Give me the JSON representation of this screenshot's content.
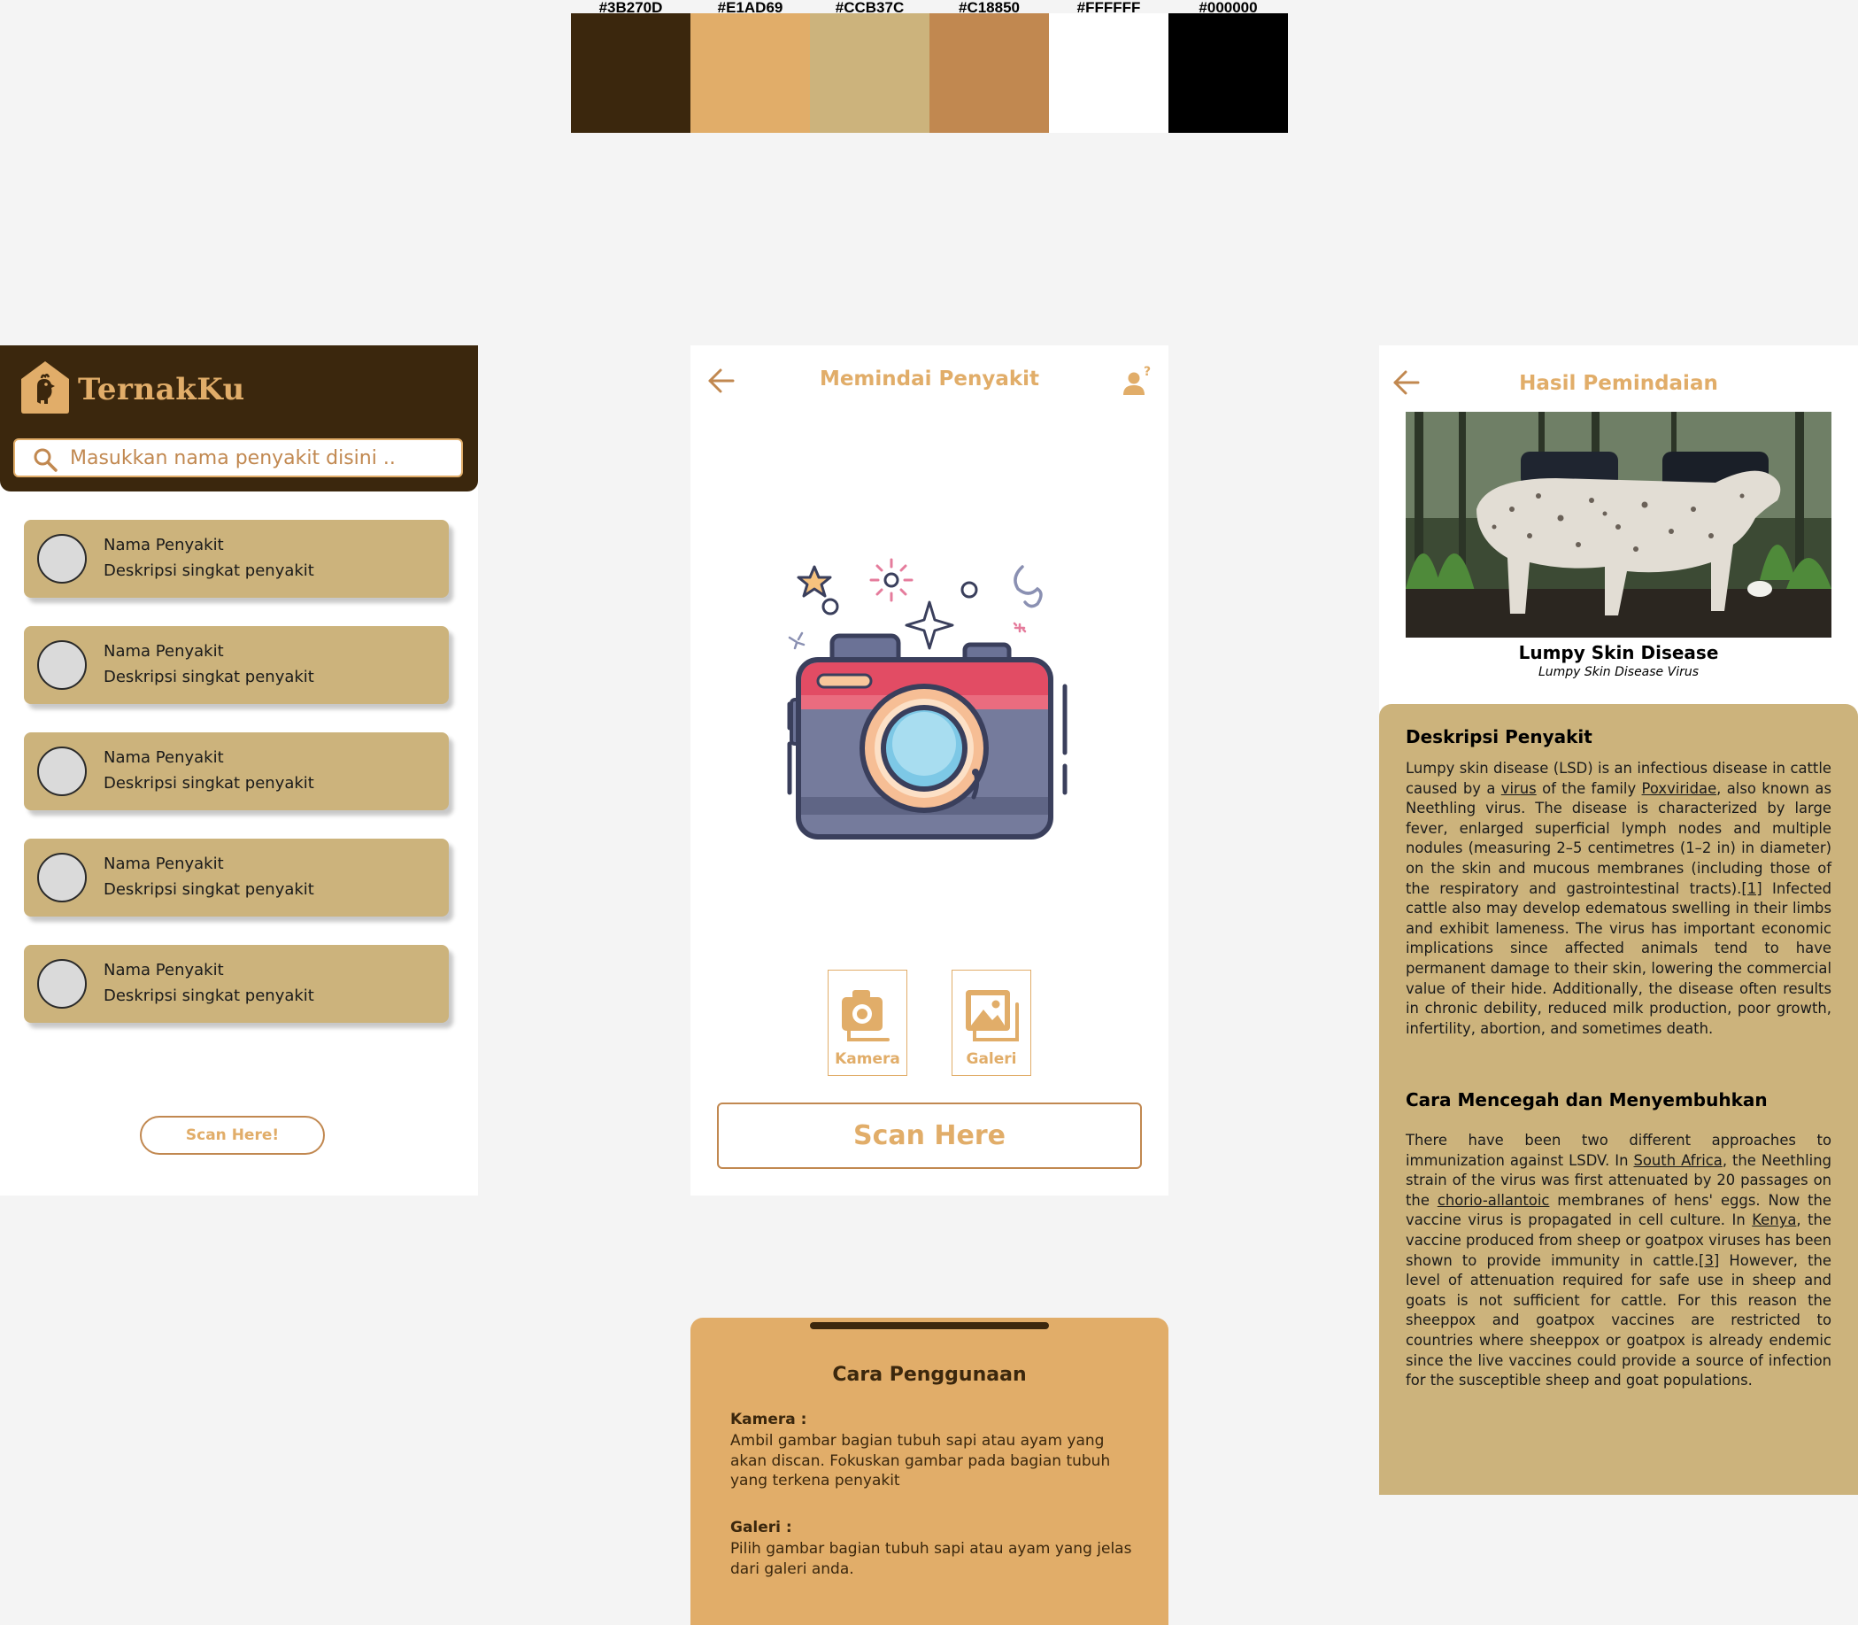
{
  "palette": [
    {
      "label": "#3B270D",
      "color": "#3B270D"
    },
    {
      "label": "#E1AD69",
      "color": "#E1AD69"
    },
    {
      "label": "#CCB37C",
      "color": "#CCB37C"
    },
    {
      "label": "#C18850",
      "color": "#C18850"
    },
    {
      "label": "#FFFFFF",
      "color": "#FFFFFF"
    },
    {
      "label": "#000000",
      "color": "#000000"
    }
  ],
  "home": {
    "app_name": "TernakKu",
    "logo_icon": "house-chicken-icon",
    "search_placeholder": "Masukkan nama penyakit disini ..",
    "items": [
      {
        "title": "Nama Penyakit",
        "desc": "Deskripsi singkat penyakit"
      },
      {
        "title": "Nama Penyakit",
        "desc": "Deskripsi singkat penyakit"
      },
      {
        "title": "Nama Penyakit",
        "desc": "Deskripsi singkat penyakit"
      },
      {
        "title": "Nama Penyakit",
        "desc": "Deskripsi singkat penyakit"
      },
      {
        "title": "Nama Penyakit",
        "desc": "Deskripsi singkat penyakit"
      }
    ],
    "scan_button": "Scan Here!"
  },
  "scan": {
    "title": "Memindai Penyakit",
    "camera_option": "Kamera",
    "gallery_option": "Galeri",
    "scan_button": "Scan Here"
  },
  "guide": {
    "title": "Cara Penggunaan",
    "kamera_heading": "Kamera :",
    "kamera_text": "Ambil gambar bagian tubuh sapi atau ayam yang akan discan. Fokuskan gambar pada bagian tubuh yang terkena penyakit",
    "galeri_heading": "Galeri :",
    "galeri_text": "Pilih gambar bagian tubuh sapi atau ayam yang jelas dari galeri anda."
  },
  "result": {
    "title": "Hasil Pemindaian",
    "disease_name": "Lumpy Skin Disease",
    "disease_sub": "Lumpy Skin Disease Virus",
    "desc_heading": "Deskripsi Penyakit",
    "desc": {
      "p1": "Lumpy skin disease (LSD) is an infectious disease in cattle caused by a ",
      "l1": "virus",
      "p2": " of the family ",
      "l2": "Poxviridae",
      "p3": ", also known as Neethling virus. The disease is characterized by large fever, enlarged superficial lymph nodes and multiple nodules (measuring 2–5 centimetres (1–2 in) in diameter) on the skin and mucous membranes (including those of the respiratory and gastrointestinal tracts).",
      "l3": "[1]",
      "p4": " Infected cattle also may develop edematous swelling in their limbs and exhibit lameness. The virus has important economic implications since affected animals tend to have permanent damage to their skin, lowering the commercial value of their hide. Additionally, the disease often results in chronic debility, reduced milk production, poor growth, infertility, abortion, and sometimes death."
    },
    "prevent_heading": "Cara Mencegah dan Menyembuhkan",
    "prevent": {
      "p1": "There have been two different approaches to immunization against LSDV. In ",
      "l1": "South Africa",
      "p2": ", the Neethling strain of the virus was first attenuated by 20 passages on the ",
      "l2": "chorio-allantoic",
      "p3": " membranes of hens' eggs. Now the vaccine virus is propagated in cell culture. In ",
      "l3": "Kenya",
      "p4": ", the vaccine produced from sheep or goatpox viruses has been shown to provide immunity in cattle.",
      "l4": "[3]",
      "p5": " However, the level of attenuation required for safe use in sheep and goats is not sufficient for cattle. For this reason the sheeppox and goatpox vaccines are restricted to countries where sheeppox or goatpox is already endemic since the live vaccines could provide a source of infection for the susceptible sheep and goat populations."
    }
  }
}
